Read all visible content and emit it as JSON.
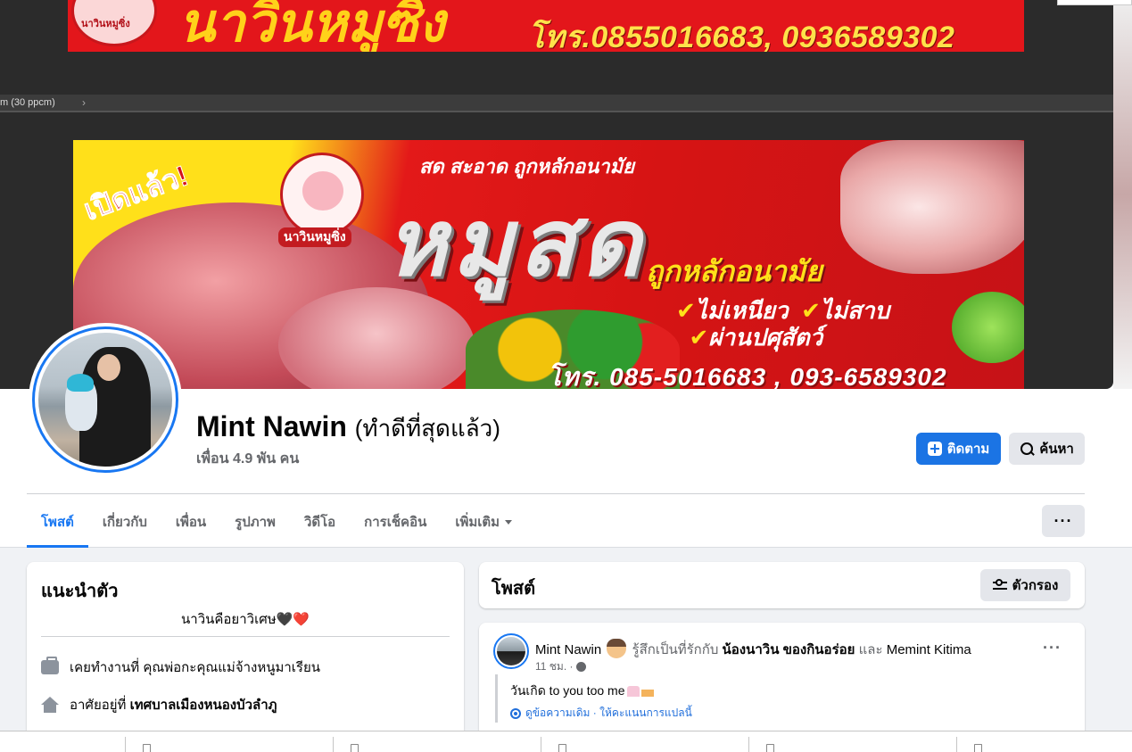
{
  "cover": {
    "top_banner_phone": "โทร.0855016683, 0936589302",
    "top_banner_logo": "นาวินหมูซิ่ง",
    "top_banner_title": "นาวินหมูซิ่ง",
    "ps_zoom_text": "m (30 ppcm)",
    "open_text": "เปิดแล้ว!",
    "logo_label": "นาวินหมูซิ่ง",
    "tagline": "สด สะอาด ถูกหลักอนามัย",
    "headline": "หมูสด",
    "subheadline": "ถูกหลักอนามัย",
    "checks": [
      "ไม่เหนียว",
      "ไม่สาบ",
      "ผ่านปศุสัตว์"
    ],
    "phone": "โทร. 085-5016683 , 093-6589302",
    "colors": {
      "banner_red": "#e3161b",
      "banner_yellow": "#ffe01a"
    }
  },
  "profile": {
    "name": "Mint Nawin",
    "alt_name": "(ทำดีที่สุดแล้ว)",
    "friends": "เพื่อน 4.9 พัน คน",
    "follow_label": "ติดตาม",
    "search_label": "ค้นหา",
    "follow_icon": "follow-plus-icon",
    "search_icon": "search-icon",
    "accent_color": "#1877f2"
  },
  "tabs": [
    {
      "label": "โพสต์",
      "active": true
    },
    {
      "label": "เกี่ยวกับ"
    },
    {
      "label": "เพื่อน"
    },
    {
      "label": "รูปภาพ"
    },
    {
      "label": "วิดีโอ"
    },
    {
      "label": "การเช็คอิน"
    },
    {
      "label": "เพิ่มเติม"
    }
  ],
  "more_button": "···",
  "intro": {
    "title": "แนะนำตัว",
    "bio": "นาวินคือยาวิเศษ🖤❤️",
    "work_prefix": "เคยทำงานที่",
    "work_value": "คุณพ่อกะคุณแม่จ้างหนูมาเรียน",
    "home_prefix": "อาศัยอยู่ที่",
    "home_value": "เทศบาลเมืองหนองบัวลำภู"
  },
  "posts": {
    "title": "โพสต์",
    "filter_label": "ตัวกรอง"
  },
  "post": {
    "author": "Mint Nawin",
    "feeling": "รู้สึกเป็นที่รักกับ",
    "tag1": "น้องนาวิน ของกินอร่อย",
    "and": "และ",
    "tag2": "Memint Kitima",
    "time": "11 ชม. ·",
    "text": "วันเกิด to you too me",
    "translate": "ดูข้อความเดิม · ให้คะแนนการแปลนี้",
    "menu": "···"
  }
}
